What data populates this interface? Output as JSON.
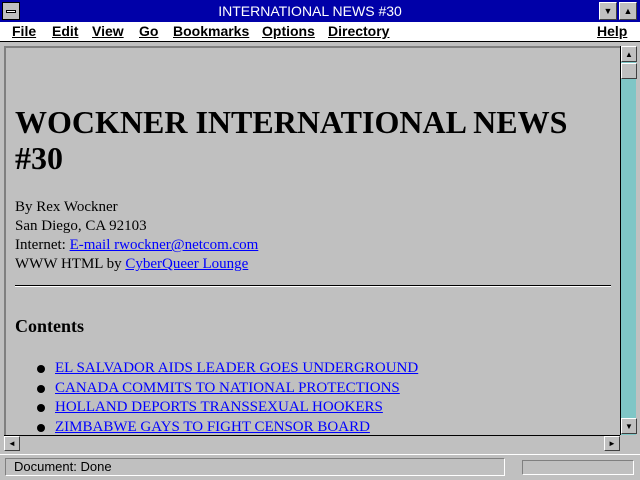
{
  "window": {
    "title": "INTERNATIONAL NEWS #30",
    "minimize_glyph": "▼",
    "maximize_glyph": "▲"
  },
  "menu": {
    "items": [
      {
        "label": "File"
      },
      {
        "label": "Edit"
      },
      {
        "label": "View"
      },
      {
        "label": "Go"
      },
      {
        "label": "Bookmarks"
      },
      {
        "label": "Options"
      },
      {
        "label": "Directory"
      },
      {
        "label": "Help"
      }
    ]
  },
  "page": {
    "heading": "WOCKNER INTERNATIONAL NEWS #30",
    "byline": {
      "author": "By Rex Wockner",
      "location": "San Diego, CA 92103",
      "internet_label": "Internet:",
      "email_link": "E-mail rwockner@netcom.com",
      "html_label": "WWW HTML by",
      "html_link": "CyberQueer Lounge"
    },
    "contents_heading": "Contents",
    "toc": [
      "EL SALVADOR AIDS LEADER GOES UNDERGROUND",
      "CANADA COMMITS TO NATIONAL PROTECTIONS",
      "HOLLAND DEPORTS TRANSSEXUAL HOOKERS",
      "ZIMBABWE GAYS TO FIGHT CENSOR BOARD"
    ]
  },
  "scroll": {
    "up_glyph": "▲",
    "down_glyph": "▼",
    "left_glyph": "◄",
    "right_glyph": "►"
  },
  "status": {
    "text": "Document: Done"
  },
  "colors": {
    "titlebar": "#0000a8",
    "link": "#0000ff",
    "scroll_track": "#7fc6c6",
    "window_bg": "#c0c0c0"
  }
}
